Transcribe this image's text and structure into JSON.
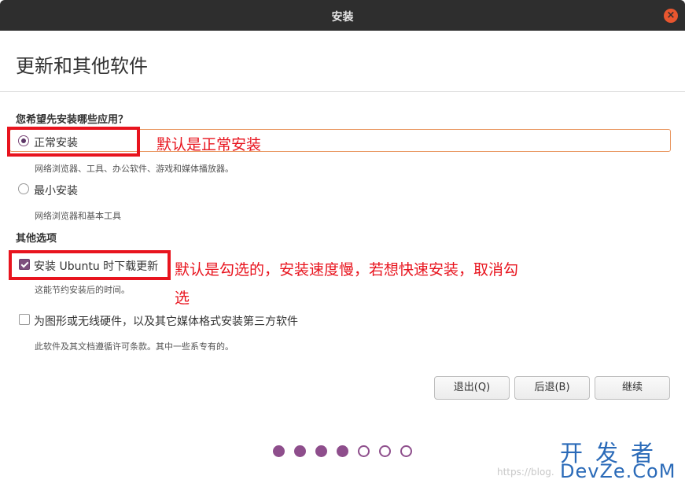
{
  "window": {
    "title": "安装",
    "close_symbol": "×"
  },
  "page": {
    "title": "更新和其他软件"
  },
  "apps_section": {
    "title": "您希望先安装哪些应用？",
    "normal": {
      "label": "正常安装",
      "desc": "网络浏览器、工具、办公软件、游戏和媒体播放器。",
      "selected": true
    },
    "minimal": {
      "label": "最小安装",
      "desc": "网络浏览器和基本工具",
      "selected": false
    }
  },
  "other_section": {
    "title": "其他选项",
    "download_updates": {
      "label": "安装 Ubuntu 时下载更新",
      "desc": "这能节约安装后的时间。",
      "checked": true
    },
    "third_party": {
      "label": "为图形或无线硬件，以及其它媒体格式安装第三方软件",
      "desc": "此软件及其文档遵循许可条款。其中一些系专有的。",
      "checked": false
    }
  },
  "buttons": {
    "quit": "退出(Q)",
    "back": "后退(B)",
    "continue": "继续"
  },
  "progress": {
    "step": 4,
    "total": 7
  },
  "annotations": {
    "normal_note": "默认是正常安装",
    "updates_note_line1": "默认是勾选的，安装速度慢，若想快速安装，取消勾",
    "updates_note_line2": "选"
  },
  "watermark": {
    "url": "https://blog.",
    "brand_top": "开发者",
    "brand_bottom": "DevZe.CoM"
  },
  "colors": {
    "accent": "#8e4e8c",
    "annotation": "#e8141e",
    "titlebar": "#2e2e2e",
    "close": "#e9562f"
  }
}
